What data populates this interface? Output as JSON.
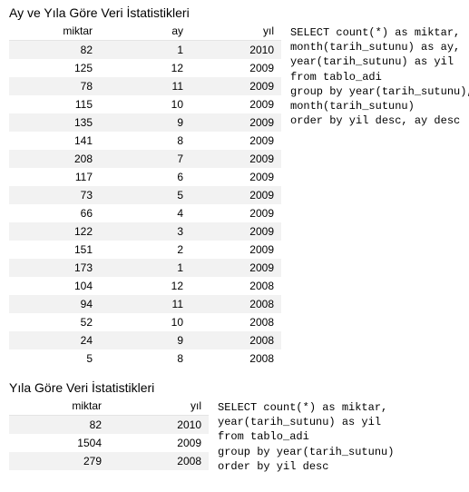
{
  "section1": {
    "title": "Ay ve Yıla Göre Veri İstatistikleri",
    "columns": [
      "miktar",
      "ay",
      "yıl"
    ],
    "rows": [
      [
        82,
        1,
        2010
      ],
      [
        125,
        12,
        2009
      ],
      [
        78,
        11,
        2009
      ],
      [
        115,
        10,
        2009
      ],
      [
        135,
        9,
        2009
      ],
      [
        141,
        8,
        2009
      ],
      [
        208,
        7,
        2009
      ],
      [
        117,
        6,
        2009
      ],
      [
        73,
        5,
        2009
      ],
      [
        66,
        4,
        2009
      ],
      [
        122,
        3,
        2009
      ],
      [
        151,
        2,
        2009
      ],
      [
        173,
        1,
        2009
      ],
      [
        104,
        12,
        2008
      ],
      [
        94,
        11,
        2008
      ],
      [
        52,
        10,
        2008
      ],
      [
        24,
        9,
        2008
      ],
      [
        5,
        8,
        2008
      ]
    ],
    "sql": "SELECT count(*) as miktar,\nmonth(tarih_sutunu) as ay,\nyear(tarih_sutunu) as yil\nfrom tablo_adi\ngroup by year(tarih_sutunu),\nmonth(tarih_sutunu)\norder by yil desc, ay desc"
  },
  "section2": {
    "title": "Yıla Göre Veri İstatistikleri",
    "columns": [
      "miktar",
      "yıl"
    ],
    "rows": [
      [
        82,
        2010
      ],
      [
        1504,
        2009
      ],
      [
        279,
        2008
      ]
    ],
    "sql": "SELECT count(*) as miktar,\nyear(tarih_sutunu) as yil\nfrom tablo_adi\ngroup by year(tarih_sutunu)\norder by yil desc"
  },
  "chart_data": [
    {
      "type": "table",
      "title": "Ay ve Yıla Göre Veri İstatistikleri",
      "columns": [
        "miktar",
        "ay",
        "yıl"
      ],
      "rows": [
        [
          82,
          1,
          2010
        ],
        [
          125,
          12,
          2009
        ],
        [
          78,
          11,
          2009
        ],
        [
          115,
          10,
          2009
        ],
        [
          135,
          9,
          2009
        ],
        [
          141,
          8,
          2009
        ],
        [
          208,
          7,
          2009
        ],
        [
          117,
          6,
          2009
        ],
        [
          73,
          5,
          2009
        ],
        [
          66,
          4,
          2009
        ],
        [
          122,
          3,
          2009
        ],
        [
          151,
          2,
          2009
        ],
        [
          173,
          1,
          2009
        ],
        [
          104,
          12,
          2008
        ],
        [
          94,
          11,
          2008
        ],
        [
          52,
          10,
          2008
        ],
        [
          24,
          9,
          2008
        ],
        [
          5,
          8,
          2008
        ]
      ]
    },
    {
      "type": "table",
      "title": "Yıla Göre Veri İstatistikleri",
      "columns": [
        "miktar",
        "yıl"
      ],
      "rows": [
        [
          82,
          2010
        ],
        [
          1504,
          2009
        ],
        [
          279,
          2008
        ]
      ]
    }
  ]
}
